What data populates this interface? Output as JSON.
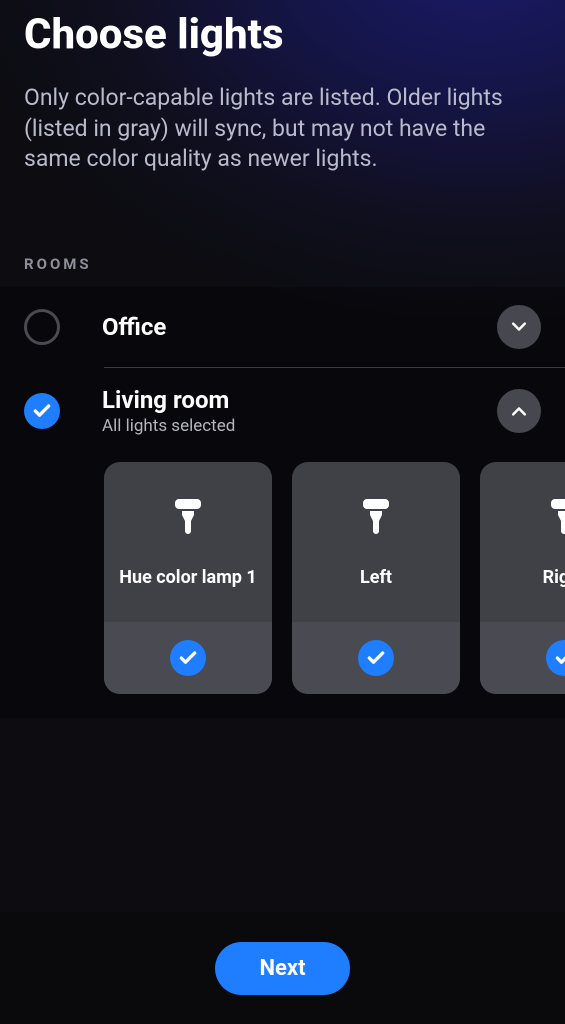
{
  "header": {
    "title": "Choose lights",
    "subtitle": "Only color-capable lights are listed. Older lights (listed in gray) will sync, but may not have the same color quality as newer lights."
  },
  "section_label": "ROOMS",
  "rooms": [
    {
      "name": "Office",
      "selected": false,
      "subtitle": "",
      "expanded": false
    },
    {
      "name": "Living room",
      "selected": true,
      "subtitle": "All lights selected",
      "expanded": true,
      "lights": [
        {
          "name": "Hue color lamp 1",
          "selected": true
        },
        {
          "name": "Left",
          "selected": true
        },
        {
          "name": "Right",
          "selected": true
        }
      ]
    }
  ],
  "footer": {
    "next_label": "Next"
  },
  "colors": {
    "accent": "#1f7dff"
  }
}
